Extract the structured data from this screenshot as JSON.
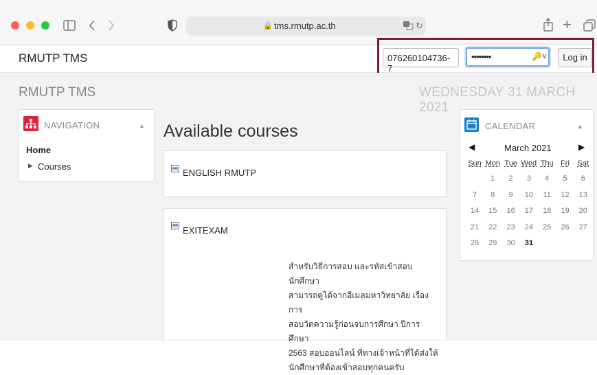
{
  "browser": {
    "address": "tms.rmutp.ac.th"
  },
  "site": {
    "brand": "RMUTP TMS",
    "login": {
      "username_value": "076260104736-7",
      "password_mask": "••••••••",
      "login_button": "Log in"
    }
  },
  "page": {
    "title": "RMUTP TMS",
    "date": "WEDNESDAY 31 MARCH 2021"
  },
  "navigation": {
    "title": "NAVIGATION",
    "home": "Home",
    "courses": "Courses"
  },
  "main": {
    "heading": "Available courses",
    "courses": [
      {
        "name": "ENGLISH RMUTP"
      },
      {
        "name": "EXITEXAM",
        "summary_lines": [
          "สำหรับวิธีการสอบ และรหัสเข้าสอบ นักศึกษา",
          "สามารถดูได้จากอีเมลมหาวิทยาลัย เรื่อง การ",
          "สอบวัดความรู้ก่อนจบการศึกษา  ปีการศึกษา",
          "2563 สอบออนไลน์ ที่ทางเจ้าหน้าที่ได้ส่งให้",
          "นักศึกษาที่ต้องเข้าสอบทุกคนครับ"
        ]
      }
    ]
  },
  "calendar": {
    "title": "CALENDAR",
    "month": "March 2021",
    "weekdays": [
      "Sun",
      "Mon",
      "Tue",
      "Wed",
      "Thu",
      "Fri",
      "Sat"
    ],
    "weeks": [
      [
        "",
        "1",
        "2",
        "3",
        "4",
        "5",
        "6"
      ],
      [
        "7",
        "8",
        "9",
        "10",
        "11",
        "12",
        "13"
      ],
      [
        "14",
        "15",
        "16",
        "17",
        "18",
        "19",
        "20"
      ],
      [
        "21",
        "22",
        "23",
        "24",
        "25",
        "26",
        "27"
      ],
      [
        "28",
        "29",
        "30",
        "31",
        "",
        "",
        ""
      ]
    ],
    "today": "31"
  },
  "colors": {
    "highlight_border": "#7a1f34",
    "nav_icon": "#d9243a",
    "calendar_icon": "#1a7fc7"
  }
}
